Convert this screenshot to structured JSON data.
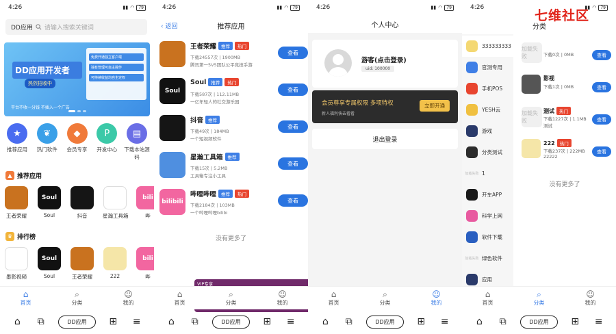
{
  "status": {
    "time": "4:26",
    "battery": "79"
  },
  "watermark": "七维社区",
  "tabs": [
    "首页",
    "分类",
    "我的"
  ],
  "sysnav": {
    "pill": "DD应用"
  },
  "home": {
    "search": {
      "app": "DD应用",
      "placeholder": "请输入搜索关键词"
    },
    "banner": {
      "title": "DD应用开发者",
      "subtitle": "热烈招收中",
      "tagline": "平台不收一分钱 不插入一个广告",
      "points": [
        "免费开通独立客户端",
        "独有管理可自主操作",
        "可持续收益均自主定权"
      ]
    },
    "quick": [
      {
        "label": "推荐应用",
        "color": "#4a6cf0"
      },
      {
        "label": "热门软件",
        "color": "#3aa0e8"
      },
      {
        "label": "会员专享",
        "color": "#f07a3a"
      },
      {
        "label": "开发中心",
        "color": "#3bc9a8"
      },
      {
        "label": "下载本站源码",
        "color": "#6a6ee6"
      }
    ],
    "rec_title": "推荐应用",
    "rec_apps": [
      {
        "name": "王者荣耀",
        "short": "",
        "color": "#c9721f"
      },
      {
        "name": "Soul",
        "short": "Soul",
        "color": "#111111"
      },
      {
        "name": "抖音",
        "short": "",
        "color": "#151515"
      },
      {
        "name": "星瀚工具箱",
        "short": "",
        "color": "#ffffff"
      },
      {
        "name": "哔",
        "short": "bili",
        "color": "#f266a0"
      }
    ],
    "rank_title": "排行榜",
    "rank_apps": [
      {
        "name": "墨影视频",
        "short": "",
        "color": "#ffffff"
      },
      {
        "name": "Soul",
        "short": "Soul",
        "color": "#111111"
      },
      {
        "name": "王者荣耀",
        "short": "",
        "color": "#c9721f"
      },
      {
        "name": "222",
        "short": "",
        "color": "#f5e6a8"
      },
      {
        "name": "哔",
        "short": "bili",
        "color": "#f266a0"
      }
    ]
  },
  "recommend": {
    "back": "返回",
    "title": "推荐应用",
    "get": "查看",
    "items": [
      {
        "name": "王者荣耀",
        "tags": [
          "推荐",
          "热门"
        ],
        "meta": "下载24557次 | 1900MB",
        "desc": "腾讯第一5V5团队公平竞技手游",
        "short": "",
        "color": "#c9721f"
      },
      {
        "name": "Soul",
        "tags": [
          "推荐",
          "热门"
        ],
        "meta": "下载587次 | 112.11MB",
        "desc": "一亿年轻人的社交游乐园",
        "short": "Soul",
        "color": "#111111"
      },
      {
        "name": "抖音",
        "tags": [
          "推荐"
        ],
        "meta": "下载49次 | 184MB",
        "desc": "一个短视频软件",
        "short": "",
        "color": "#151515"
      },
      {
        "name": "星瀚工具箱",
        "tags": [
          "推荐"
        ],
        "meta": "下载15次 | 5.2MB",
        "desc": "工具箱专注小工具",
        "short": "",
        "color": "#4f8fe0"
      },
      {
        "name": "哔哩哔哩",
        "tags": [
          "推荐",
          "热门",
          "VIP专享"
        ],
        "meta": "下载2184次 | 103MB",
        "desc": "一个哔哩哔哩bilibi",
        "short": "bilibili",
        "color": "#f266a0"
      }
    ],
    "no_more": "没有更多了"
  },
  "profile": {
    "title": "个人中心",
    "guest": "游客(点击登录)",
    "uid": "uid: 100000",
    "vip_title": "会员尊享专属权限 多项特权",
    "vip_sub": "新人福利快去看看",
    "vip_button": "立即开通",
    "logout": "退出登录"
  },
  "category": {
    "title": "分类",
    "get": "查看",
    "no_more": "没有更多了",
    "side": [
      {
        "label": "333333333",
        "color": "#f4d873",
        "icon": "bunny",
        "active": true
      },
      {
        "label": "官测专用",
        "color": "#3f7fe6",
        "icon": "DD"
      },
      {
        "label": "手机POS",
        "color": "#e8452f",
        "icon": "pos"
      },
      {
        "label": "YESH云",
        "color": "#f0c040",
        "icon": "yesh"
      },
      {
        "label": "游戏",
        "color": "#2a3a6a",
        "icon": "game"
      },
      {
        "label": "分类测试",
        "color": "#2c2c2c",
        "icon": "panda"
      },
      {
        "label": "1",
        "color": "",
        "icon": "loading"
      },
      {
        "label": "开车APP",
        "color": "#1a1a1a",
        "icon": "car"
      },
      {
        "label": "科学上网",
        "color": "#e85aa0",
        "icon": "net"
      },
      {
        "label": "软件下载",
        "color": "#2a5fc0",
        "icon": "dl"
      },
      {
        "label": "绿色软件",
        "color": "",
        "icon": "loading"
      },
      {
        "label": "应用",
        "color": "#2a3a6a",
        "icon": "app"
      }
    ],
    "loading_text": "加载失败",
    "items": [
      {
        "name": "",
        "tags": [],
        "meta": "下载0次 | 0MB",
        "desc": "",
        "color": "",
        "load": true
      },
      {
        "name": "影视",
        "tags": [],
        "meta": "下载1次 | 0MB",
        "desc": "",
        "color": "#555555",
        "load": false
      },
      {
        "name": "测试",
        "tags": [
          "热门"
        ],
        "meta": "下载1227次 | 1.1MB",
        "desc": "测试",
        "color": "",
        "load": true
      },
      {
        "name": "222",
        "tags": [
          "热门"
        ],
        "meta": "下载237次 | 222MB",
        "desc": "22222",
        "color": "#f5e6a8",
        "load": false
      }
    ]
  }
}
